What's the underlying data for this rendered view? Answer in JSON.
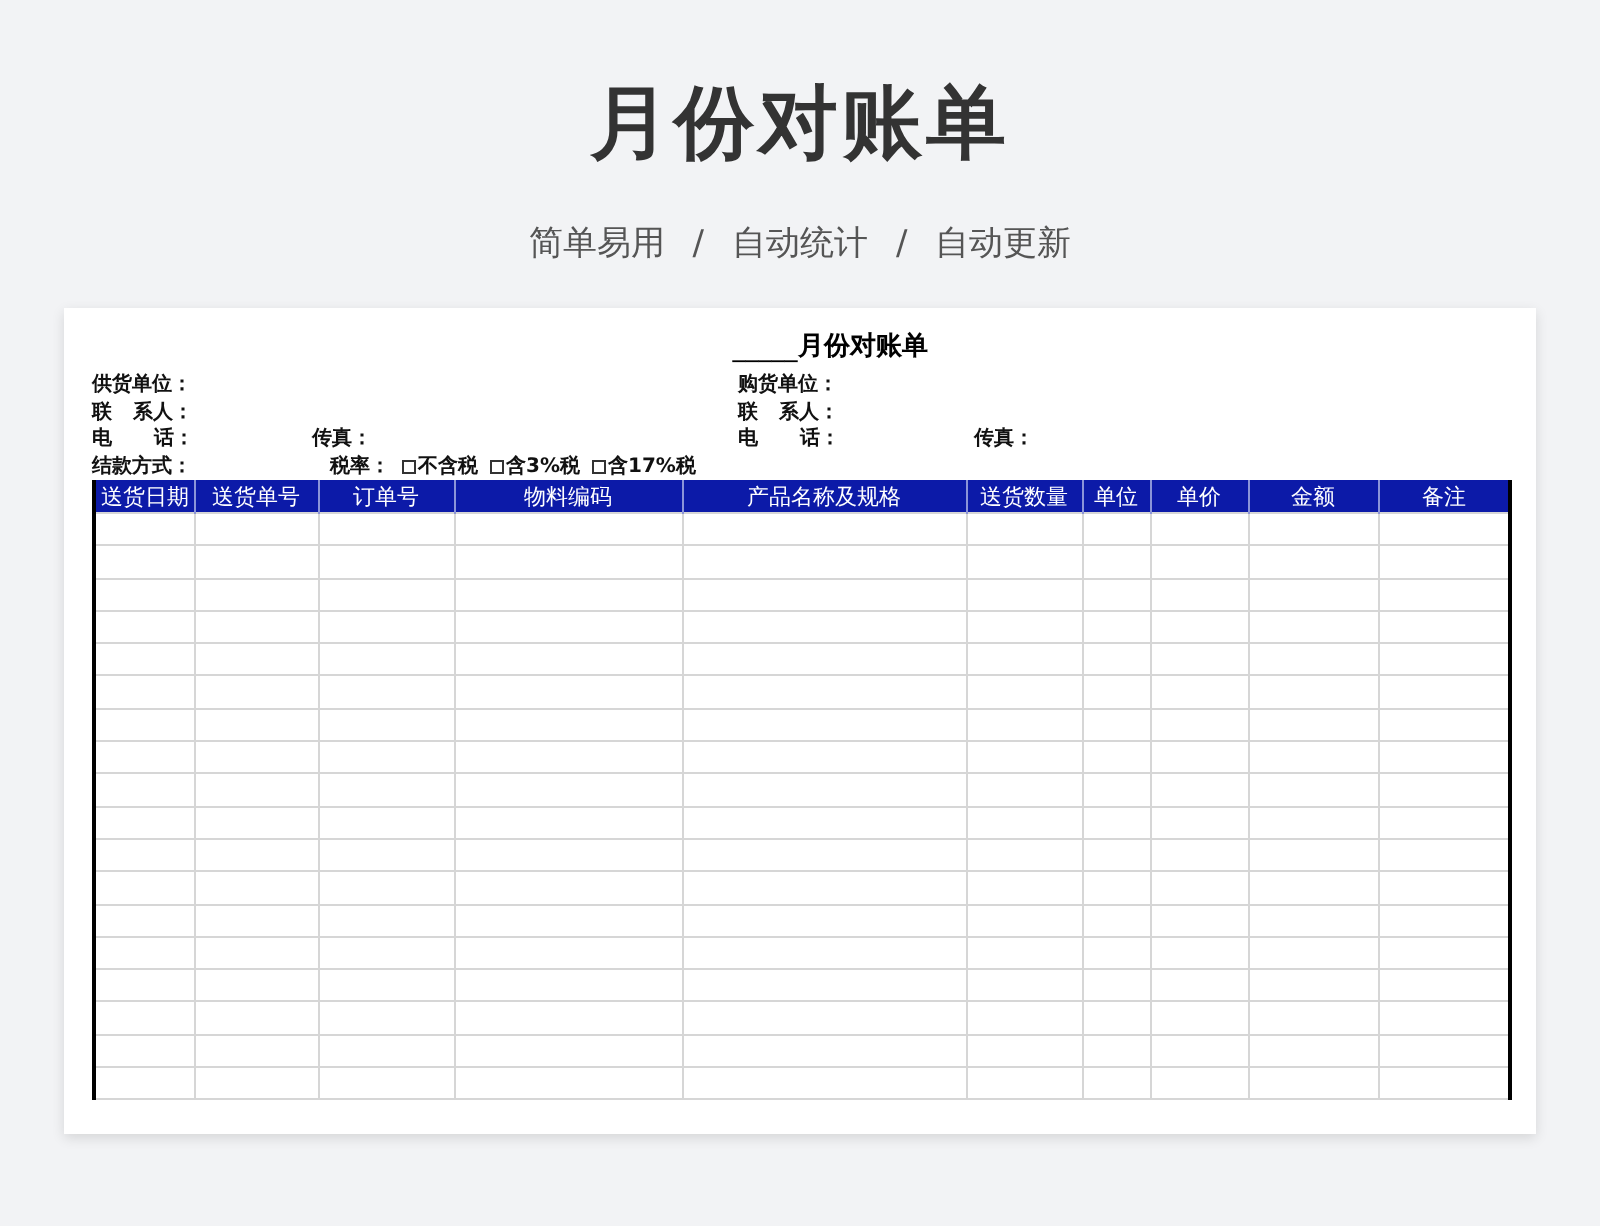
{
  "page_title": "月份对账单",
  "subtitle": [
    "简单易用",
    "自动统计",
    "自动更新"
  ],
  "separator": "/",
  "sheet": {
    "title_blank": "_____",
    "title": "月份对账单",
    "info_rows": [
      {
        "left": "供货单位：",
        "right": "购货单位："
      },
      {
        "left": "联   系人：",
        "right": "联   系人："
      },
      {
        "left": "电      话：",
        "left_fax": "传真：",
        "right": "电      话：",
        "right_fax": "传真："
      }
    ],
    "payment": "结款方式：",
    "tax": {
      "label": "税率：",
      "options": [
        {
          "label": "不含税",
          "checked": false
        },
        {
          "label": "含3%税",
          "checked": false
        },
        {
          "label": "含17%税",
          "checked": false
        }
      ]
    },
    "columns": [
      "送货日期",
      "送货单号",
      "订单号",
      "物料编码",
      "产品名称及规格",
      "送货数量",
      "单位",
      "单价",
      "金额",
      "备注"
    ]
  }
}
